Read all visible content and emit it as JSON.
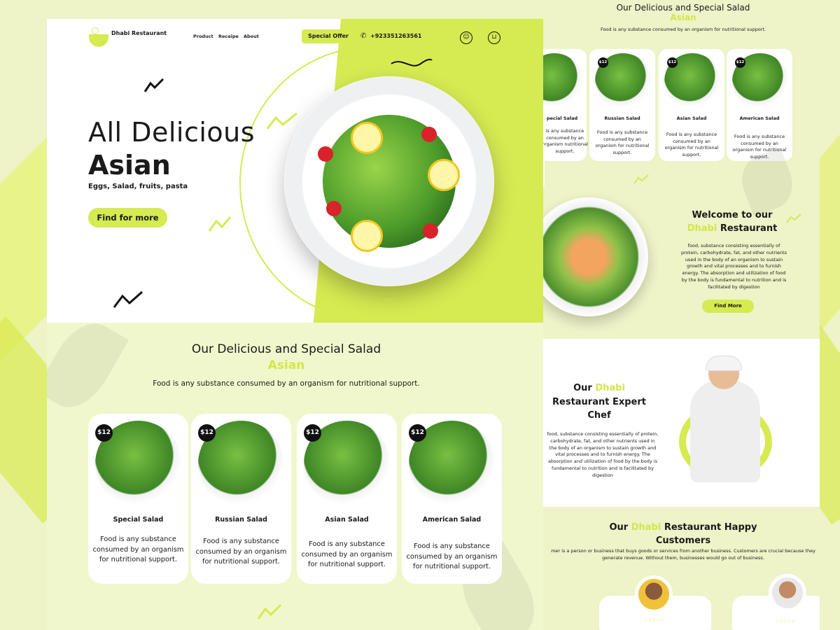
{
  "brand": {
    "name": "Dhabi Restaurant"
  },
  "nav": {
    "links": [
      "Product",
      "Receipe",
      "About"
    ],
    "offer_label": "Special Offer",
    "phone": "+923351263561"
  },
  "hero": {
    "title_line1": "All Delicious",
    "title_line2": "Asian",
    "subtitle": "Eggs, Salad, fruits, pasta",
    "cta_label": "Find for more"
  },
  "special": {
    "title": "Our Delicious and Special Salad",
    "accent": "Asian",
    "description": "Food is any substance consumed by an organism for nutritional support.",
    "cards": [
      {
        "price": "$12",
        "name": "Special Salad",
        "desc": "Food is any substance consumed by an organism for nutritional support."
      },
      {
        "price": "$12",
        "name": "Russian Salad",
        "desc": "Food is any substance consumed by an organism for nutritional support."
      },
      {
        "price": "$12",
        "name": "Asian Salad",
        "desc": "Food is any substance consumed by an organism for nutritional support."
      },
      {
        "price": "$12",
        "name": "American Salad",
        "desc": "Food is any substance consumed by an organism for nutritional support."
      }
    ]
  },
  "right": {
    "special_title": "Our Delicious and Special Salad",
    "special_accent": "Asian",
    "special_desc": "Food is any substance consumed by an organism for nutritional support.",
    "cards": [
      {
        "price": "",
        "name": "pecial Salad",
        "desc": "is any substance consumed by an organism nutritional support."
      },
      {
        "price": "$12",
        "name": "Russian Salad",
        "desc": "Food is any substance consumed by an organism for nutritional support."
      },
      {
        "price": "$12",
        "name": "Asian Salad",
        "desc": "Food is any substance consumed by an organism for nutritional support."
      },
      {
        "price": "$12",
        "name": "American Salad",
        "desc": "Food is any substance consumed by an organism for nutritional support."
      }
    ],
    "welcome": {
      "line1": "Welcome to our",
      "accent": "Dhabi",
      "line2_rest": "Restaurant",
      "desc": "food, substance consisting essentially of protein, carbohydrate, fat, and other nutrients used in the body of an organism to sustain growth and vital processes and to furnish energy. The absorption and utilization of food by the body is fundamental to nutrition and is facilitated by digestion",
      "cta": "Find More"
    },
    "chef": {
      "prefix": "Our",
      "accent": "Dhabi",
      "line2": "Restaurant Expert",
      "line3": "Chef",
      "desc": "food, substance consisting essentially of protein, carbohydrate, fat, and other nutrients used in the body of an organism to sustain growth and vital processes and to furnish energy. The absorption and utilization of food by the body is fundamental to nutrition and is facilitated by digestion"
    },
    "customers": {
      "prefix": "Our",
      "accent": "Dhabi",
      "rest": "Restaurant Happy",
      "line2": "Customers",
      "desc": "mer is a person or business that buys goods or services from another business. Customers are crucial because they generate revenue. Without them, businesses would go out of business.",
      "stars": "☆☆☆☆☆"
    }
  },
  "colors": {
    "accent": "#d6ea52",
    "dark": "#111111",
    "bg": "#eef3c8"
  }
}
